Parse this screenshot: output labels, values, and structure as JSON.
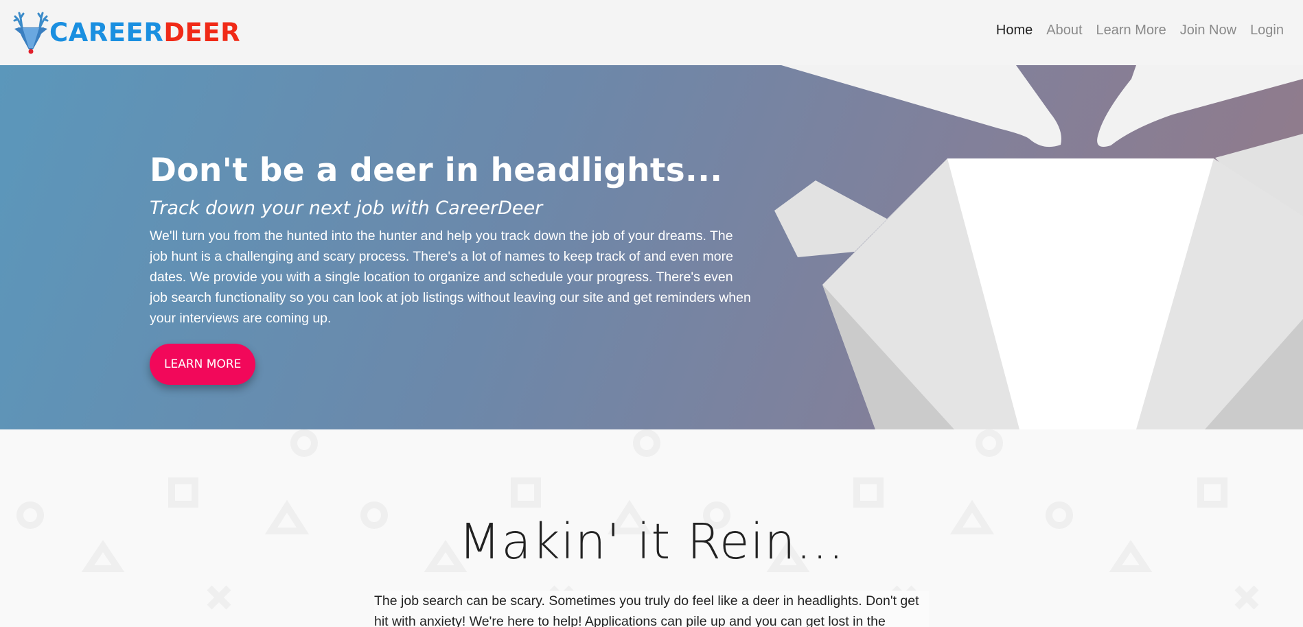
{
  "brand": {
    "name_part1": "CAREER",
    "name_part2": "DEER",
    "logo_icon": "deer-head-icon",
    "colors": {
      "career": "#1a8fe0",
      "deer": "#f02a17"
    }
  },
  "nav": {
    "items": [
      {
        "label": "Home",
        "active": true
      },
      {
        "label": "About",
        "active": false
      },
      {
        "label": "Learn More",
        "active": false
      },
      {
        "label": "Join Now",
        "active": false
      },
      {
        "label": "Login",
        "active": false
      }
    ]
  },
  "hero": {
    "title": "Don't be a deer in headlights...",
    "subtitle": "Track down your next job with CareerDeer",
    "body": "We'll turn you from the hunted into the hunter and help you track down the job of your dreams. The job hunt is a challenging and scary process. There's a lot of names to keep track of and even more dates. We provide you with a single location to organize and schedule your progress. There's even job search functionality so you can look at job listings without leaving our site and get reminders when your interviews are coming up.",
    "button_label": "LEARN MORE",
    "colors": {
      "button": "#f2085a",
      "gradient_start": "#5b97bb",
      "gradient_end": "#947a88"
    }
  },
  "section2": {
    "title": "Makin' it Rein...",
    "body": "The job search can be scary. Sometimes you truly do feel like a deer in headlights. Don't get hit with anxiety! We're here to help! Applications can pile up and you can get lost in the"
  }
}
